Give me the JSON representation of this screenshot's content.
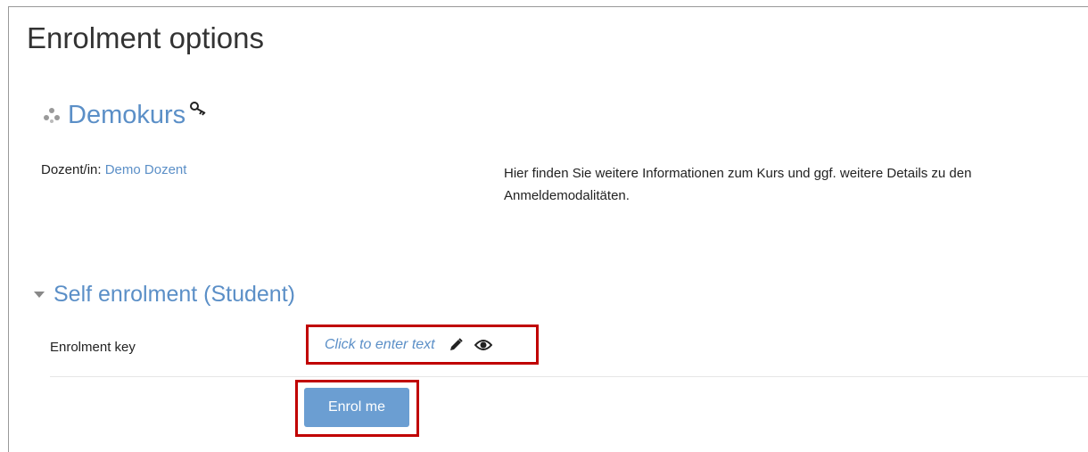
{
  "page": {
    "title": "Enrolment options"
  },
  "course": {
    "name": "Demokurs",
    "teacher_label": "Dozent/in:",
    "teacher_name": "Demo Dozent",
    "summary": "Hier finden Sie weitere Informationen zum Kurs und ggf. weitere Details zu den Anmeldemodalitäten.",
    "icons": {
      "course": "course-dots-icon",
      "key": "key-icon"
    }
  },
  "self_enrolment": {
    "heading": "Self enrolment (Student)",
    "key_label": "Enrolment key",
    "key_placeholder": "Click to enter text",
    "icons": {
      "edit": "pencil-icon",
      "reveal": "eye-icon"
    },
    "button_label": "Enrol me"
  },
  "colors": {
    "link": "#5b8fc7",
    "button": "#6b9ed2",
    "highlight_border": "#c00000"
  }
}
